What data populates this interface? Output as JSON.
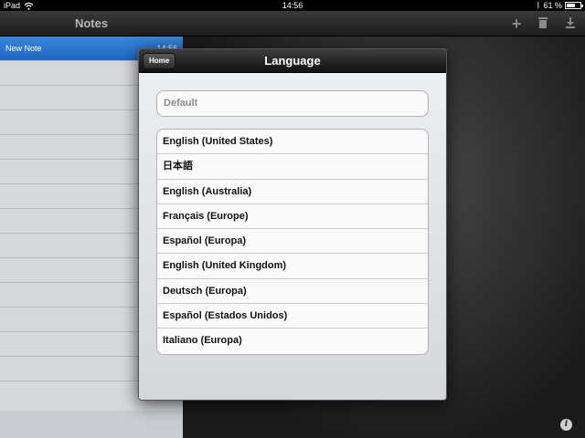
{
  "status_bar": {
    "carrier": "iPad",
    "time": "14:56",
    "battery": "61 %",
    "battery_level": 0.61
  },
  "left_pane": {
    "title": "Notes",
    "notes": [
      {
        "title": "New Note",
        "time": "14:56"
      }
    ]
  },
  "toolbar": {
    "icons": [
      "add-icon",
      "trash-icon",
      "download-icon"
    ]
  },
  "popover": {
    "title": "Language",
    "home_label": "Home",
    "default_placeholder": "Default",
    "languages": [
      "English (United States)",
      "日本語",
      "English (Australia)",
      "Français (Europe)",
      "Español (Europa)",
      "English (United Kingdom)",
      "Deutsch (Europa)",
      "Español (Estados Unidos)",
      "Italiano (Europa)"
    ]
  },
  "colors": {
    "selected_row": "#2a74cf",
    "nav_bar": "#1c1c1c"
  }
}
